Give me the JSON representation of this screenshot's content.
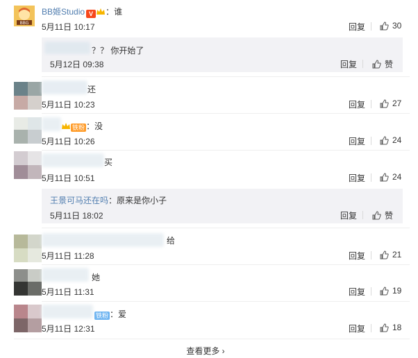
{
  "comments": [
    {
      "user": "BB姬Studio",
      "separator": "：",
      "text": "谁",
      "time": "5月11日 10:17",
      "reply": "回复",
      "likes": "30"
    },
    {
      "user": "",
      "separator": "",
      "text": "还",
      "time": "5月11日 10:23",
      "reply": "回复",
      "likes": "27"
    },
    {
      "user": "",
      "separator": "：",
      "text": "没",
      "time": "5月11日 10:26",
      "reply": "回复",
      "likes": "24",
      "badge": "铁粉"
    },
    {
      "user": "",
      "separator": "",
      "text": "买",
      "time": "5月11日 10:51",
      "reply": "回复",
      "likes": "24"
    },
    {
      "user": "",
      "separator": "",
      "text": "给",
      "time": "5月11日 11:28",
      "reply": "回复",
      "likes": "21"
    },
    {
      "user": "",
      "separator": "",
      "text": "她",
      "time": "5月11日 11:31",
      "reply": "回复",
      "likes": "19"
    },
    {
      "user": "",
      "separator": "：",
      "text": "爱",
      "time": "5月11日 12:31",
      "reply": "回复",
      "likes": "18",
      "badge": "铁粉"
    }
  ],
  "subreplies": [
    {
      "user": "",
      "text": "？？ 你开始了",
      "time": "5月12日 09:38",
      "reply": "回复",
      "likes": "赞"
    },
    {
      "user": "王景可马还在吗",
      "separator": "：",
      "text": "原来是你小子",
      "time": "5月11日 18:02",
      "reply": "回复",
      "likes": "赞"
    }
  ],
  "more": {
    "label": "查看更多",
    "arrow": "›"
  },
  "icons": {
    "like": "thumbs-up-icon",
    "vip": "v-verified-icon",
    "crown": "crown-icon"
  },
  "colors": {
    "username_orange": "#eb7350",
    "username_blue": "#507daf",
    "sub_bg": "#f2f2f5"
  }
}
